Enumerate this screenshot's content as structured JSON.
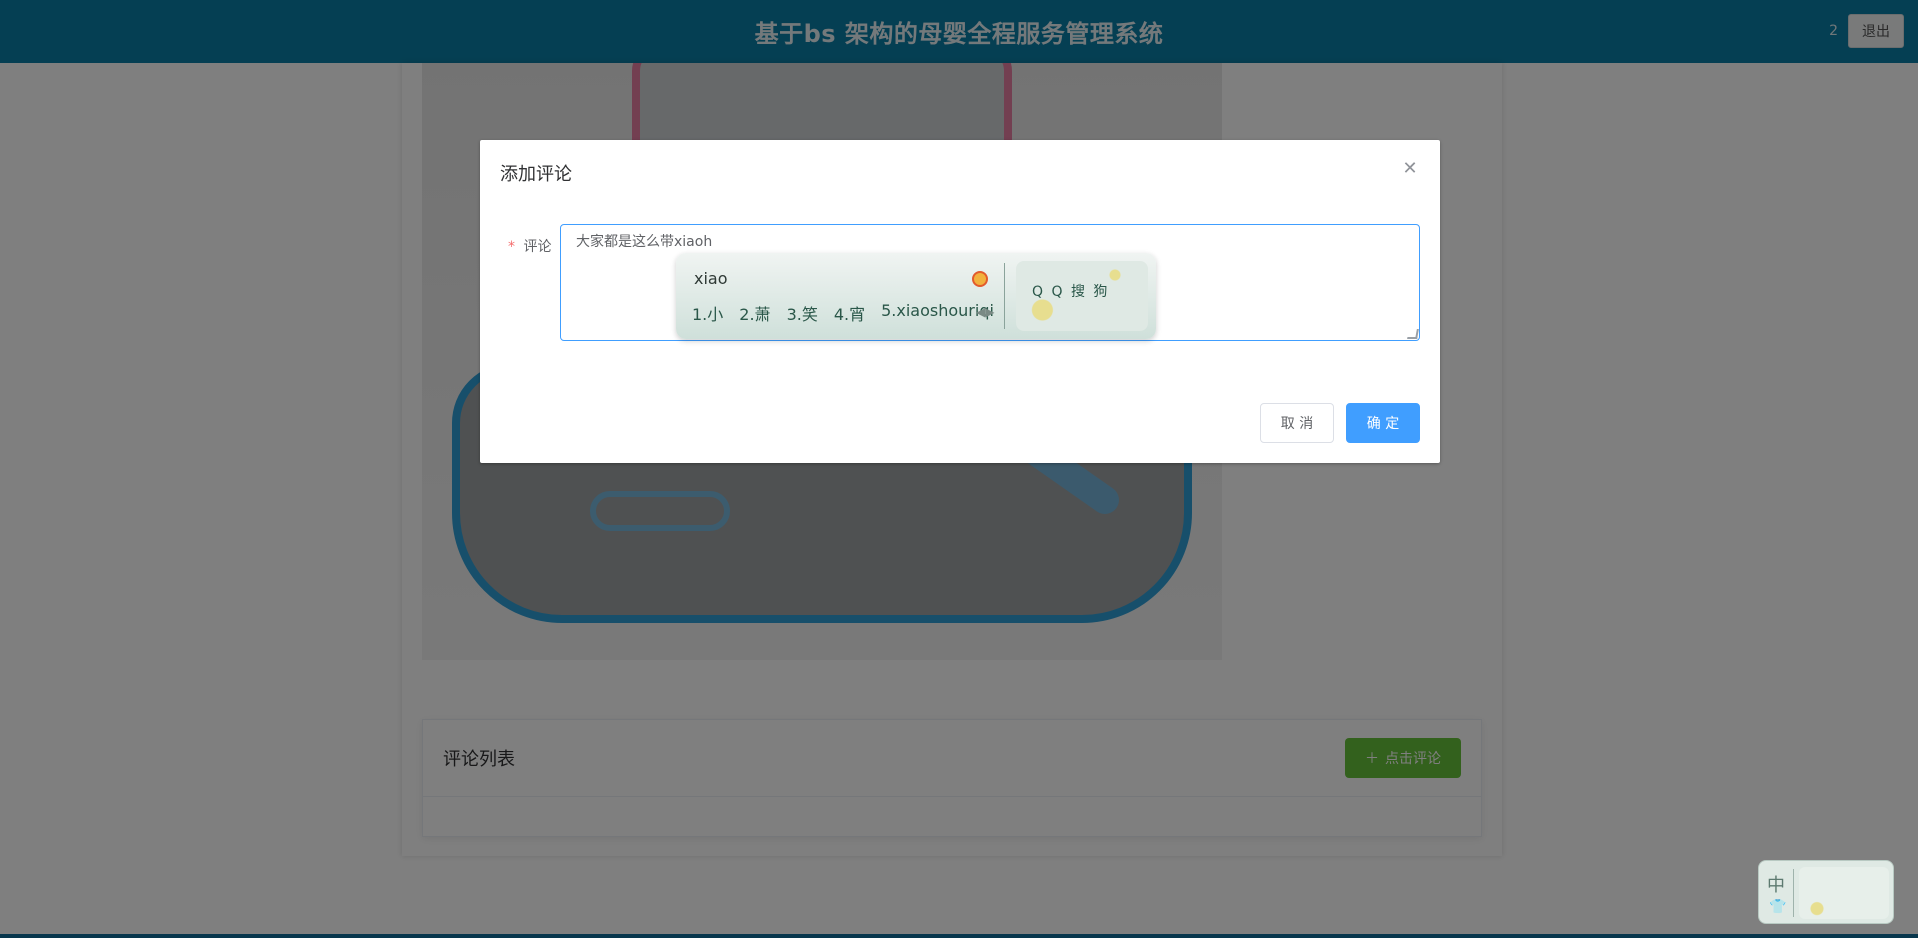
{
  "header": {
    "title": "基于bs 架构的母婴全程服务管理系统",
    "user_label": "2",
    "logout_label": "退出"
  },
  "comments": {
    "title": "评论列表",
    "add_button_label": "点击评论",
    "add_icon": "plus-icon"
  },
  "dialog": {
    "title": "添加评论",
    "close_icon": "close-icon",
    "required_mark": "*",
    "field_label": "评论",
    "comment_value": "大家都是这么带xiaoh",
    "cancel_label": "取 消",
    "confirm_label": "确 定"
  },
  "ime": {
    "composition": "xiao",
    "candidates": [
      "1.小",
      "2.萧",
      "3.笑",
      "4.宵",
      "5.xiaoshouriqi"
    ],
    "skin_text": "Q Q 搜 狗"
  },
  "ime_status": {
    "mode": "中",
    "skin_icon": "shirt-icon"
  },
  "colors": {
    "header_bg": "#0b7fa6",
    "primary": "#409eff",
    "success": "#67c23a",
    "danger": "#f56c6c"
  }
}
